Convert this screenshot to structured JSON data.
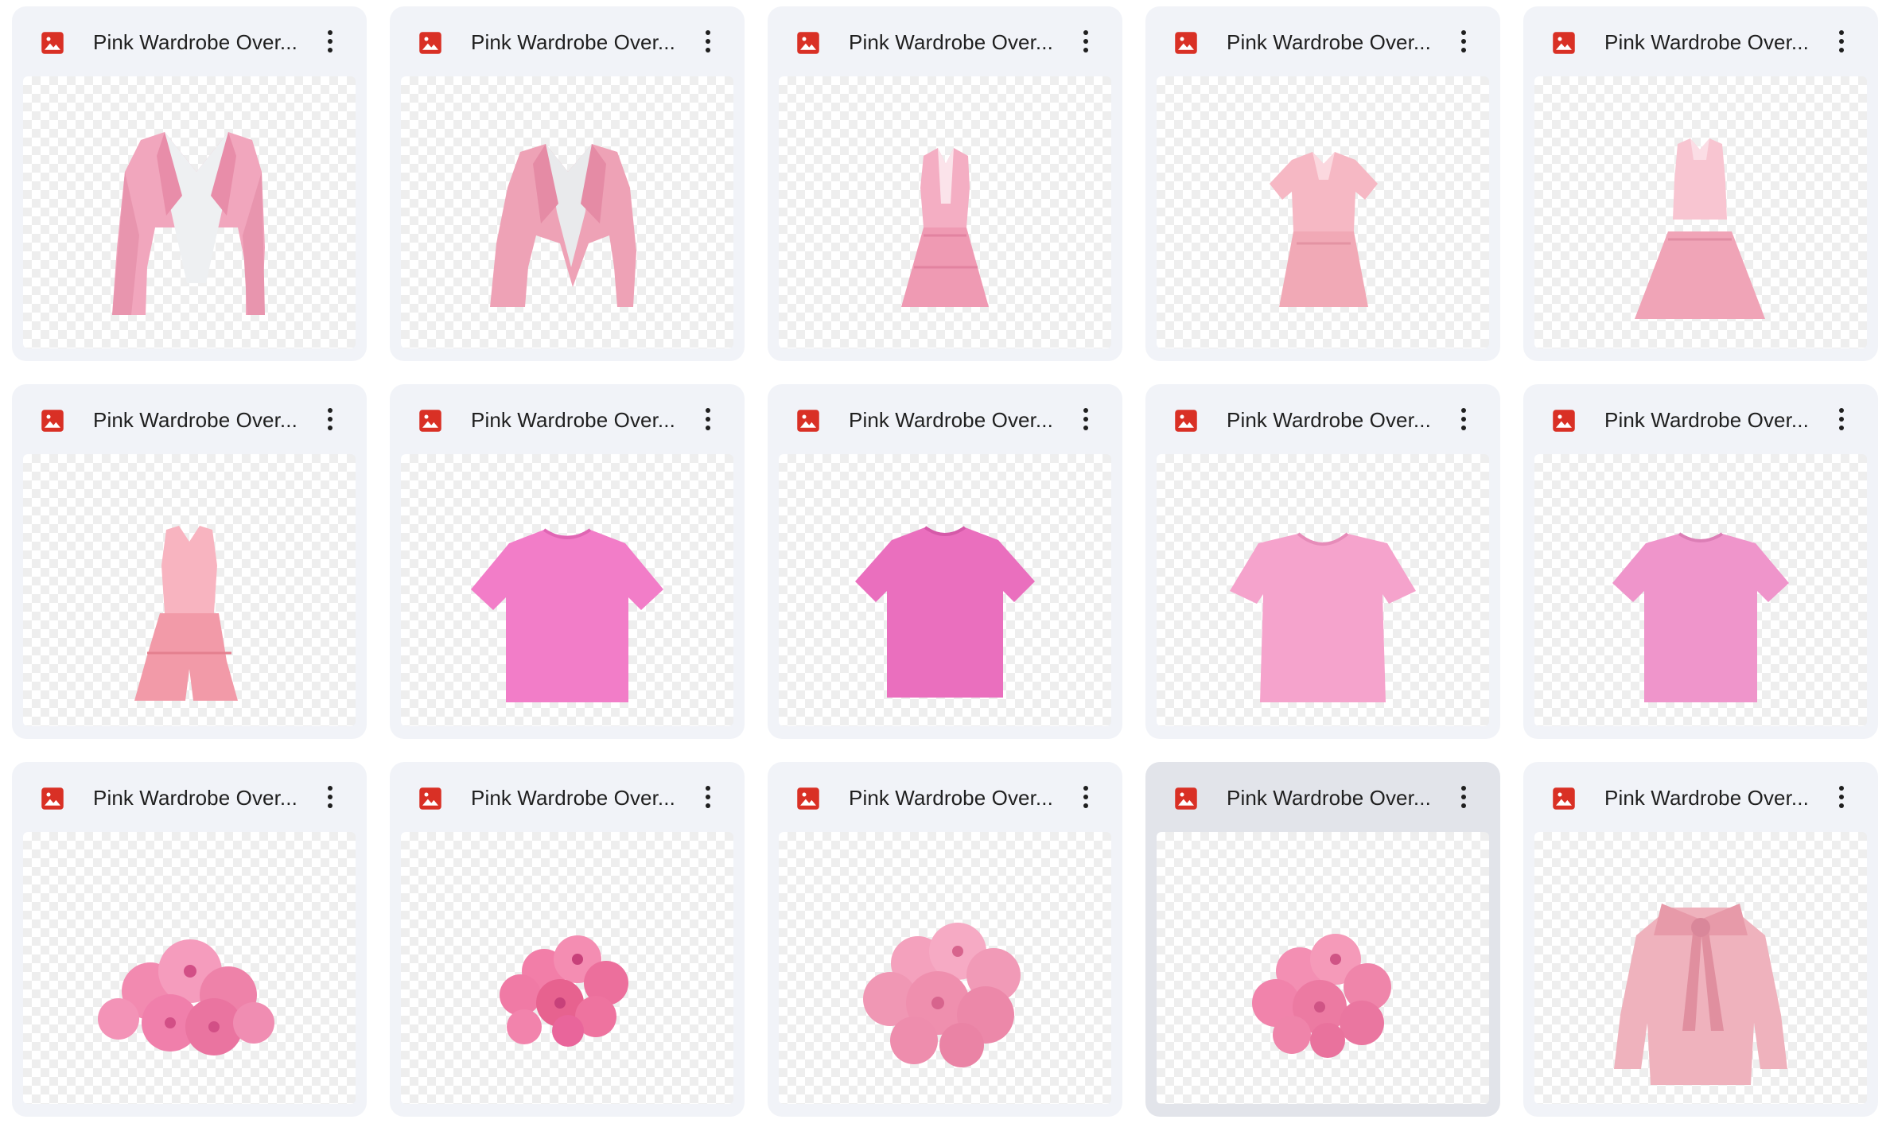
{
  "colors": {
    "card_bg": "#f1f3f8",
    "card_selected_bg": "#e2e4ea",
    "image_icon_red": "#d93025",
    "title_text": "#1f1f1f"
  },
  "files": [
    {
      "title": "Pink Wardrobe Over...",
      "thumbnail": "pink-cropped-blazer-white-top",
      "selected": false
    },
    {
      "title": "Pink Wardrobe Over...",
      "thumbnail": "pink-cropped-blazer-angled",
      "selected": false
    },
    {
      "title": "Pink Wardrobe Over...",
      "thumbnail": "pink-sleeveless-collared-dress",
      "selected": false
    },
    {
      "title": "Pink Wardrobe Over...",
      "thumbnail": "pink-polo-shirt-skirt-set",
      "selected": false
    },
    {
      "title": "Pink Wardrobe Over...",
      "thumbnail": "pink-crop-top-pleated-skirt",
      "selected": false
    },
    {
      "title": "Pink Wardrobe Over...",
      "thumbnail": "pink-tank-top-shorts-set",
      "selected": false
    },
    {
      "title": "Pink Wardrobe Over...",
      "thumbnail": "pink-tshirt-bright",
      "selected": false
    },
    {
      "title": "Pink Wardrobe Over...",
      "thumbnail": "pink-tshirt-magenta",
      "selected": false
    },
    {
      "title": "Pink Wardrobe Over...",
      "thumbnail": "pink-tshirt-light",
      "selected": false
    },
    {
      "title": "Pink Wardrobe Over...",
      "thumbnail": "pink-tshirt-soft",
      "selected": false
    },
    {
      "title": "Pink Wardrobe Over...",
      "thumbnail": "pink-flower-cluster",
      "selected": false
    },
    {
      "title": "Pink Wardrobe Over...",
      "thumbnail": "pink-flower-cluster-small",
      "selected": false
    },
    {
      "title": "Pink Wardrobe Over...",
      "thumbnail": "pink-flower-mound",
      "selected": false
    },
    {
      "title": "Pink Wardrobe Over...",
      "thumbnail": "pink-flower-cluster-round",
      "selected": true
    },
    {
      "title": "Pink Wardrobe Over...",
      "thumbnail": "pink-satin-bow-blouse",
      "selected": false
    }
  ]
}
